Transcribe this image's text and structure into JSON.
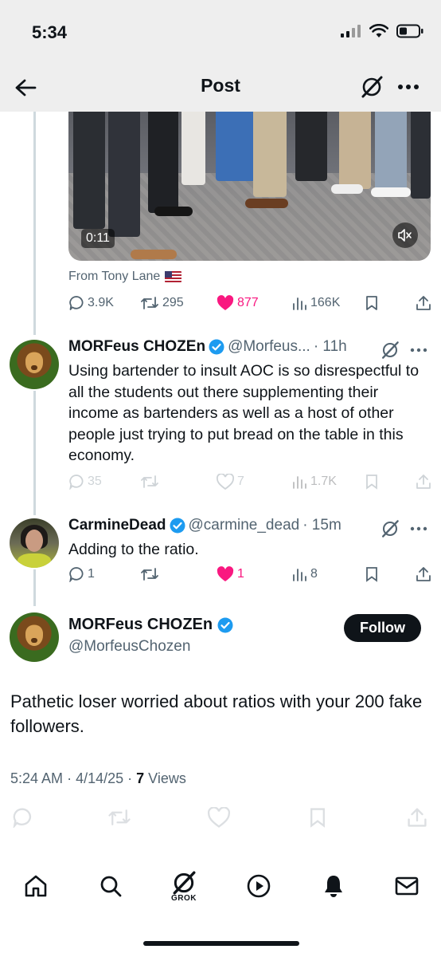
{
  "status_bar": {
    "time": "5:34"
  },
  "header": {
    "title": "Post"
  },
  "video_post": {
    "duration": "0:11",
    "from_text": "From Tony Lane",
    "actions": {
      "replies": "3.9K",
      "reposts": "295",
      "likes": "877",
      "views": "166K"
    },
    "liked": true,
    "like_color": "#f91880"
  },
  "replies": [
    {
      "name": "MORFeus CHOZEn",
      "handle": "@Morfeus...",
      "time": "· 11h",
      "text": "Using bartender to insult AOC is so disrespectful to all the students out there supplementing their income as bartenders as well as a host of other people just trying to put bread on the table in this economy.",
      "actions": {
        "replies": "35",
        "reposts": "",
        "likes": "7",
        "views": "1.7K"
      }
    },
    {
      "name": "CarmineDead",
      "handle": "@carmine_dead",
      "time": "· 15m",
      "text": "Adding to the ratio.",
      "actions": {
        "replies": "1",
        "reposts": "",
        "likes": "1",
        "views": "8"
      },
      "liked": true
    }
  ],
  "main_post": {
    "name": "MORFeus CHOZEn",
    "handle": "@MorfeusChozen",
    "follow_label": "Follow",
    "text": "Pathetic loser worried about ratios with your 200 fake followers.",
    "time": "5:24 AM",
    "date": "4/14/25",
    "views_count": "7",
    "views_label": "Views"
  },
  "bottom_nav": {
    "grok_label": "GROK"
  },
  "colors": {
    "verified": "#1d9bf0",
    "like": "#f91880",
    "text": "#0f1419",
    "secondary": "#536471"
  }
}
